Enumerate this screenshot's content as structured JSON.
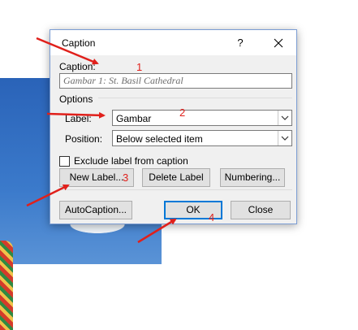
{
  "dialog": {
    "title": "Caption",
    "help_label": "?",
    "caption_label": "Caption:",
    "caption_value": "Gambar 1: St. Basil Cathedral",
    "options_label": "Options",
    "label_label": "Label:",
    "label_value": "Gambar",
    "position_label": "Position:",
    "position_value": "Below selected item",
    "exclude_label": "Exclude label from caption",
    "new_label_button": "New Label...",
    "delete_label_button": "Delete Label",
    "numbering_button": "Numbering...",
    "autocaption_button": "AutoCaption...",
    "ok_button": "OK",
    "close_button": "Close"
  },
  "annotations": {
    "n1": "1",
    "n2": "2",
    "n3": "3",
    "n4": "4",
    "color": "#e0201b"
  },
  "icons": [
    "close-icon",
    "chevron-down-icon",
    "annotation-arrow"
  ]
}
